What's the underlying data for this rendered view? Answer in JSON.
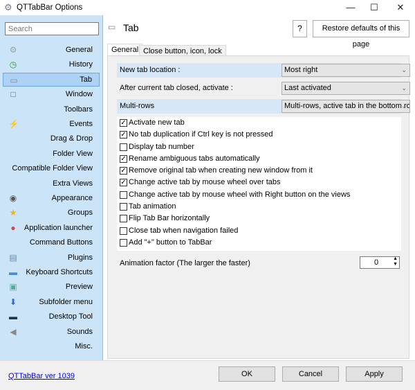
{
  "window": {
    "title": "QTTabBar Options",
    "minimize": "—",
    "maximize": "☐",
    "close": "✕"
  },
  "sidebar": {
    "search_placeholder": "Search",
    "items": [
      {
        "label": "General",
        "icon": "gear-icon",
        "glyph": "⚙",
        "color": "#8aa"
      },
      {
        "label": "History",
        "icon": "history-icon",
        "glyph": "◷",
        "color": "#2a9d2a"
      },
      {
        "label": "Tab",
        "icon": "tab-icon",
        "glyph": "▭",
        "color": "#889",
        "selected": true
      },
      {
        "label": "Window",
        "icon": "window-icon",
        "glyph": "□",
        "color": "#667"
      },
      {
        "label": "Toolbars",
        "icon": "",
        "glyph": "",
        "color": ""
      },
      {
        "label": "Events",
        "icon": "lightning-icon",
        "glyph": "⚡",
        "color": "#e0b000"
      },
      {
        "label": "Drag & Drop",
        "icon": "",
        "glyph": "",
        "color": ""
      },
      {
        "label": "Folder View",
        "icon": "",
        "glyph": "",
        "color": ""
      },
      {
        "label": "Compatible Folder View",
        "icon": "",
        "glyph": "",
        "color": ""
      },
      {
        "label": "Extra Views",
        "icon": "",
        "glyph": "",
        "color": ""
      },
      {
        "label": "Appearance",
        "icon": "eye-icon",
        "glyph": "◉",
        "color": "#555"
      },
      {
        "label": "Groups",
        "icon": "star-icon",
        "glyph": "★",
        "color": "#f0b020"
      },
      {
        "label": "Application launcher",
        "icon": "launcher-icon",
        "glyph": "●",
        "color": "#d44"
      },
      {
        "label": "Command Buttons",
        "icon": "",
        "glyph": "",
        "color": ""
      },
      {
        "label": "Plugins",
        "icon": "plugin-icon",
        "glyph": "▤",
        "color": "#68a"
      },
      {
        "label": "Keyboard Shortcuts",
        "icon": "keyboard-icon",
        "glyph": "▬",
        "color": "#4a8ad0"
      },
      {
        "label": "Preview",
        "icon": "picture-icon",
        "glyph": "▣",
        "color": "#5a9"
      },
      {
        "label": "Subfolder menu",
        "icon": "subfolder-icon",
        "glyph": "⬇",
        "color": "#2a6ad0"
      },
      {
        "label": "Desktop Tool",
        "icon": "desktop-icon",
        "glyph": "▬",
        "color": "#234"
      },
      {
        "label": "Sounds",
        "icon": "speaker-icon",
        "glyph": "◀",
        "color": "#888"
      },
      {
        "label": "Misc.",
        "icon": "",
        "glyph": "",
        "color": ""
      }
    ]
  },
  "header": {
    "title": "Tab",
    "help": "?",
    "restore": "Restore defaults of this page"
  },
  "tabs": [
    "General",
    "Close button, icon, lock"
  ],
  "settings": [
    {
      "label": "New tab location :",
      "value": "Most right"
    },
    {
      "label": "After current tab closed, activate :",
      "value": "Last activated"
    },
    {
      "label": "Multi-rows",
      "value": "Multi-rows, active tab in the bottom row"
    }
  ],
  "checkboxes": [
    {
      "label": "Activate new tab",
      "checked": true
    },
    {
      "label": "No tab duplication if Ctrl key is not pressed",
      "checked": true
    },
    {
      "label": "Display tab number",
      "checked": false
    },
    {
      "label": "Rename ambiguous tabs automatically",
      "checked": true
    },
    {
      "label": "Remove original tab when creating new window from it",
      "checked": true
    },
    {
      "label": "Change active tab by mouse wheel over tabs",
      "checked": true
    },
    {
      "label": "Change active tab by mouse wheel with Right button on the views",
      "checked": false
    },
    {
      "label": "Tab animation",
      "checked": false
    },
    {
      "label": "Flip Tab Bar horizontally",
      "checked": false
    },
    {
      "label": "Close tab when navigation failed",
      "checked": false
    },
    {
      "label": "Add \"+\" button to TabBar",
      "checked": false
    }
  ],
  "animation": {
    "label": "Animation factor (The larger the faster)",
    "value": "0"
  },
  "footer": {
    "version_link": "QTTabBar ver 1039",
    "ok": "OK",
    "cancel": "Cancel",
    "apply": "Apply"
  },
  "colors": {
    "sidebar": "#cce4f7",
    "selected": "#aed2f5",
    "link": "#0000ee"
  }
}
